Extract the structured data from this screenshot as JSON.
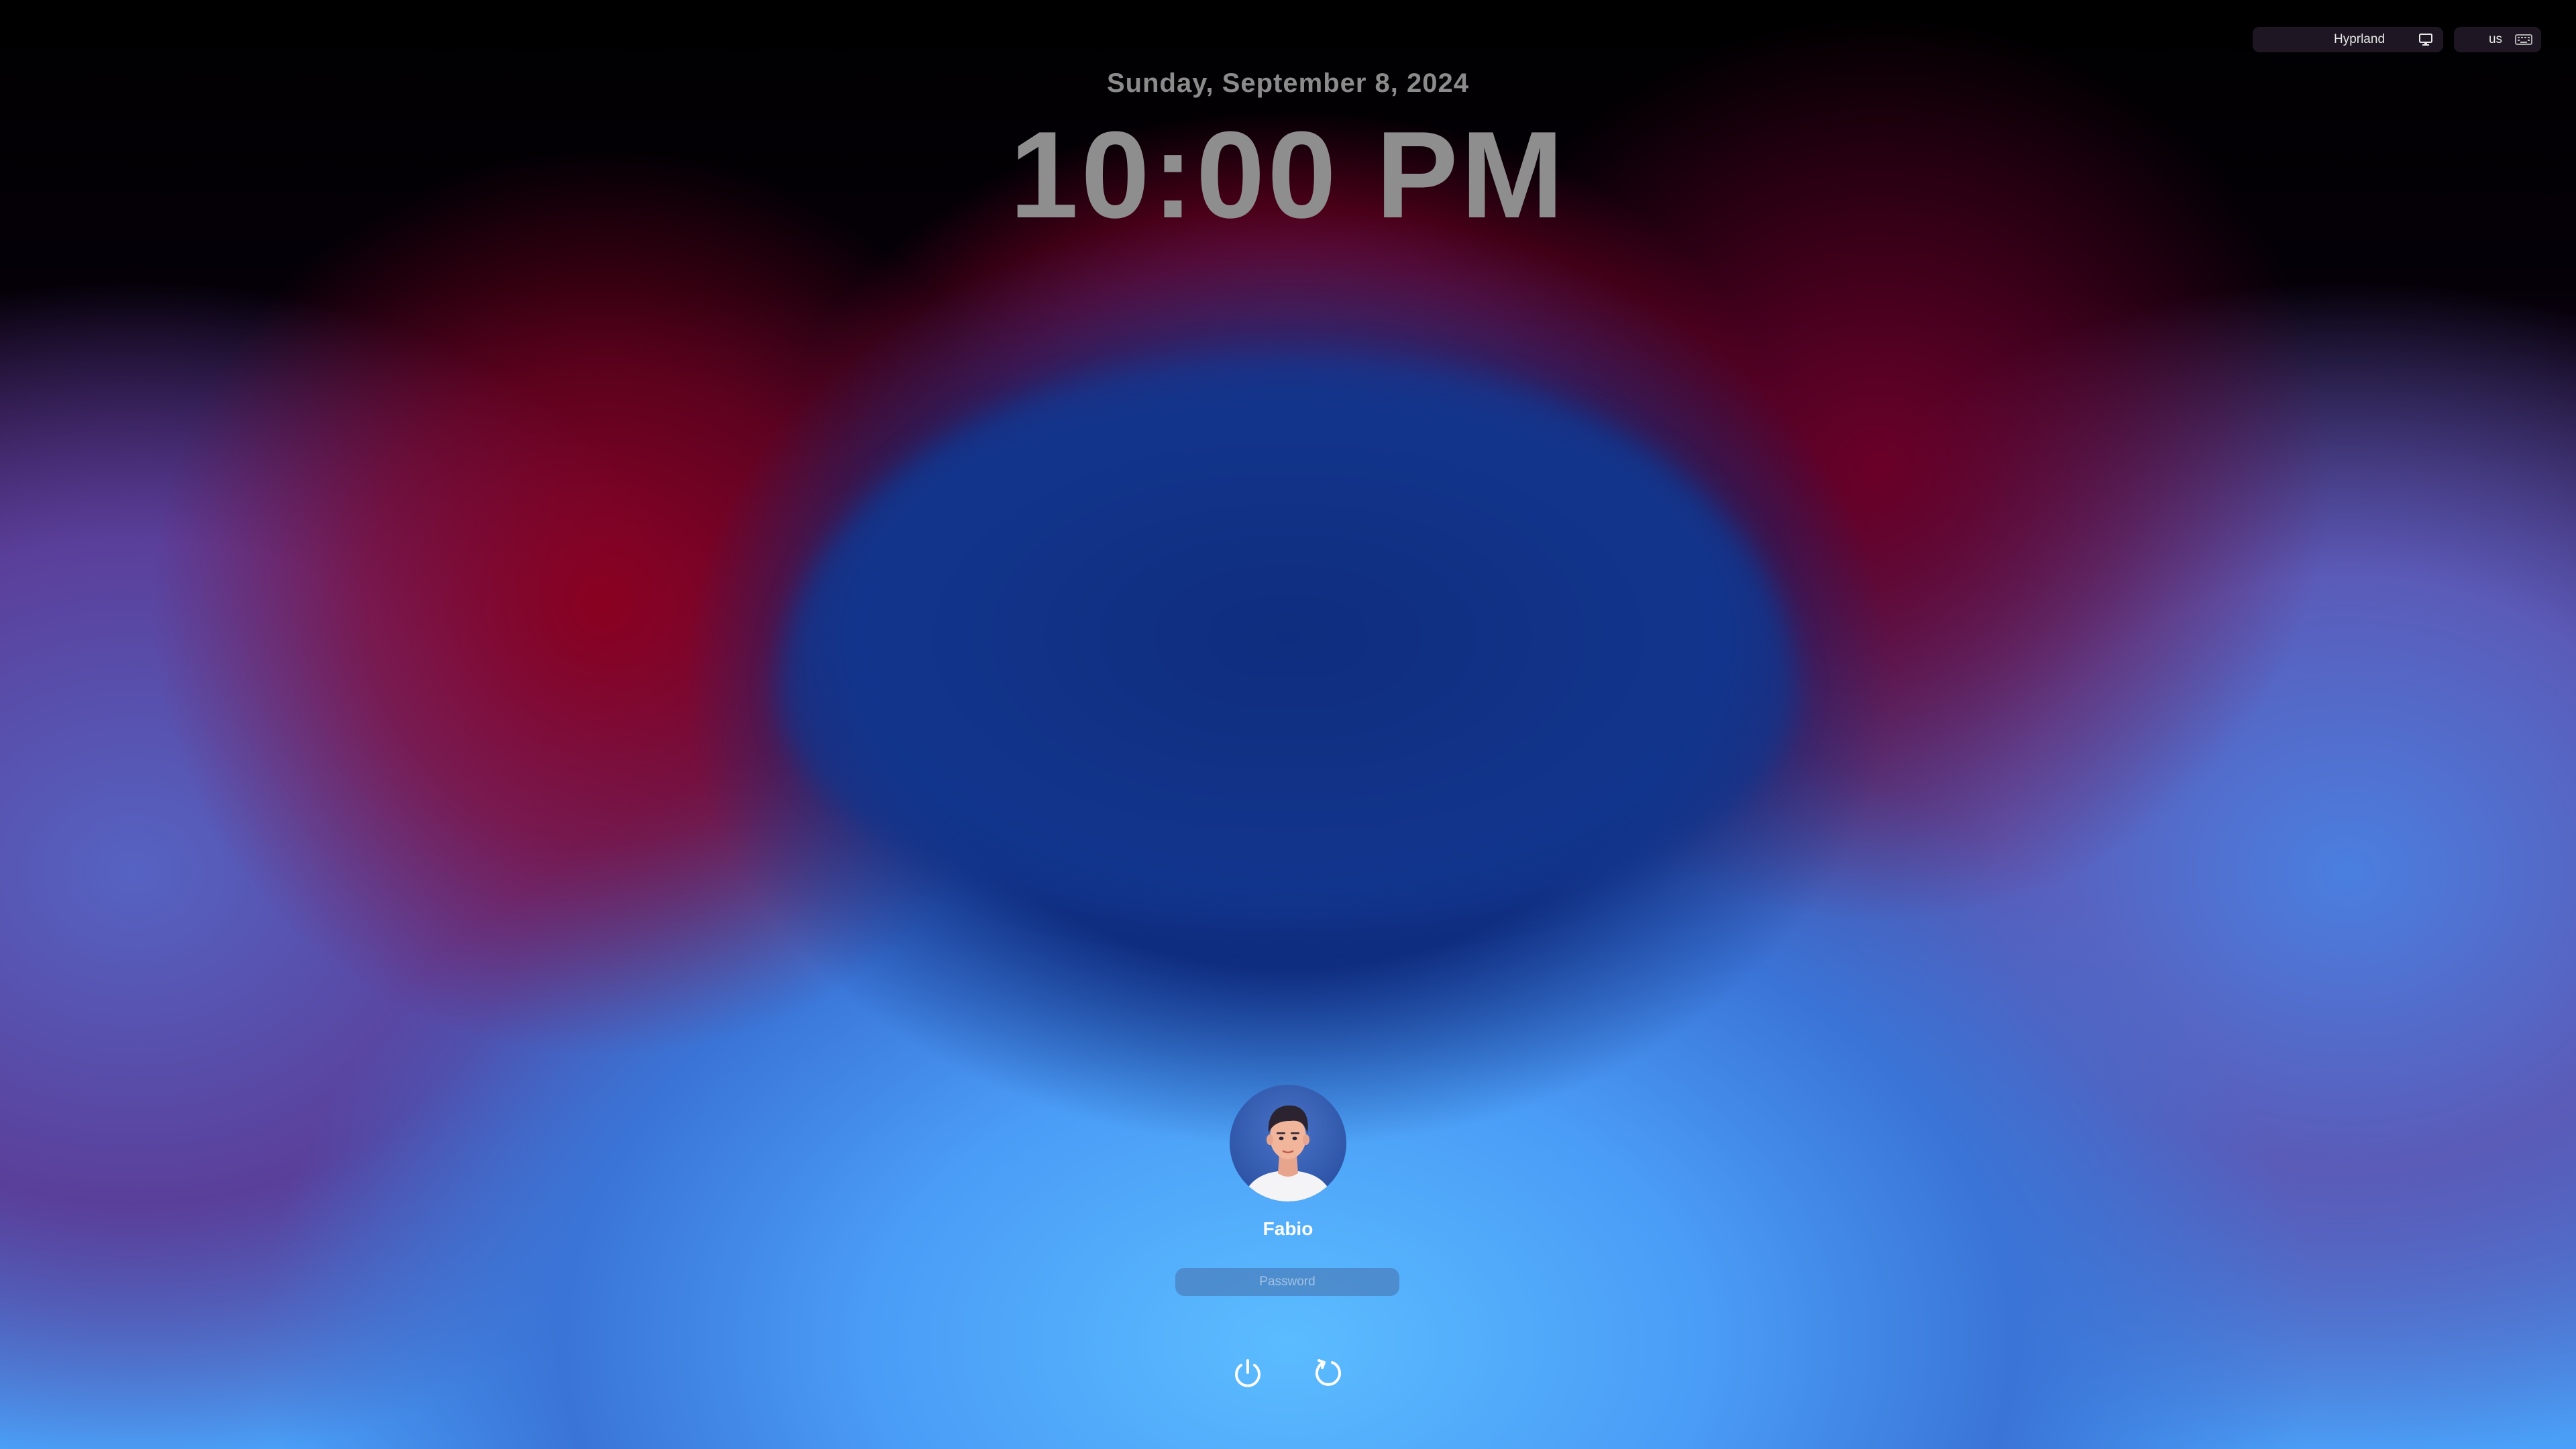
{
  "lockscreen": {
    "date": "Sunday, September 8, 2024",
    "time": "10:00 PM"
  },
  "topbar": {
    "session_label": "Hyprland",
    "session_icon": "monitor-icon",
    "keyboard_layout": "us",
    "keyboard_icon": "keyboard-icon"
  },
  "user": {
    "name": "Fabio",
    "avatar": "avatar-illustration"
  },
  "password": {
    "placeholder": "Password",
    "value": ""
  },
  "actions": {
    "power_icon": "power-icon",
    "reboot_icon": "reboot-icon"
  },
  "colors": {
    "text_dim": "#8e8e8e",
    "text_light": "#ffffff",
    "accent_blue": "#4aa0f8",
    "accent_red": "#c0102a"
  }
}
